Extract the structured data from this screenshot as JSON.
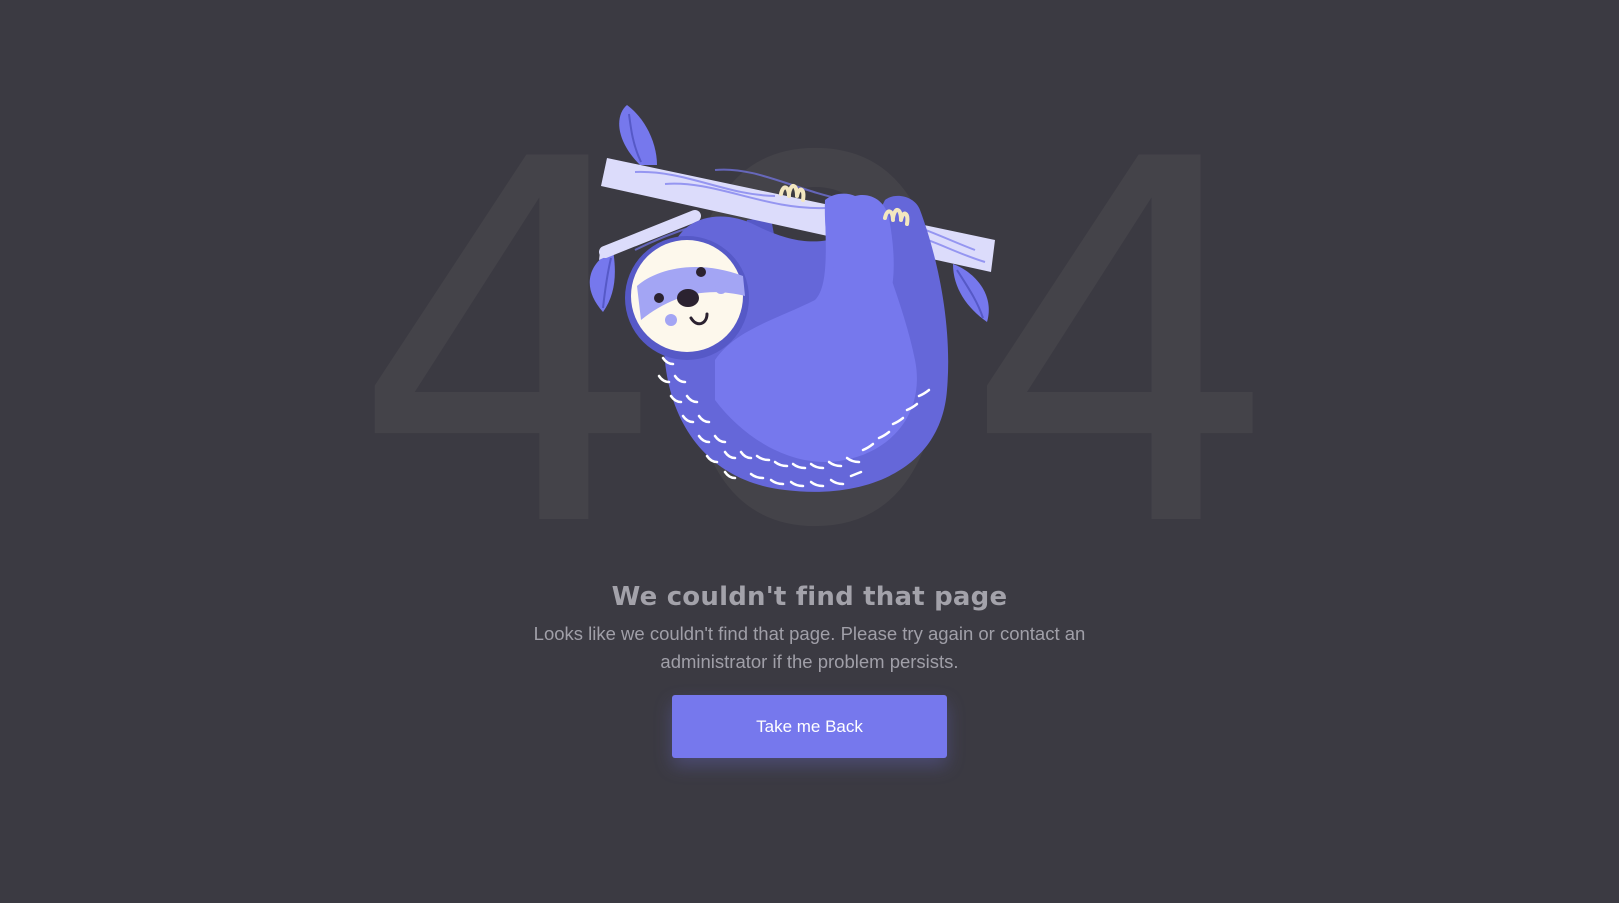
{
  "error_code": "404",
  "illustration": {
    "icon": "sloth-hanging-on-branch-icon",
    "colors": {
      "body": "#7678ed",
      "body_dark": "#5659c7",
      "branch": "#dcdcfb",
      "face": "#fdf8ec"
    }
  },
  "title": "We couldn't find that page",
  "message": "Looks like we couldn't find that page. Please try again or contact an administrator if the problem persists.",
  "button": {
    "label": "Take me Back"
  },
  "colors": {
    "background": "#3b3a42",
    "accent": "#7678ed"
  }
}
